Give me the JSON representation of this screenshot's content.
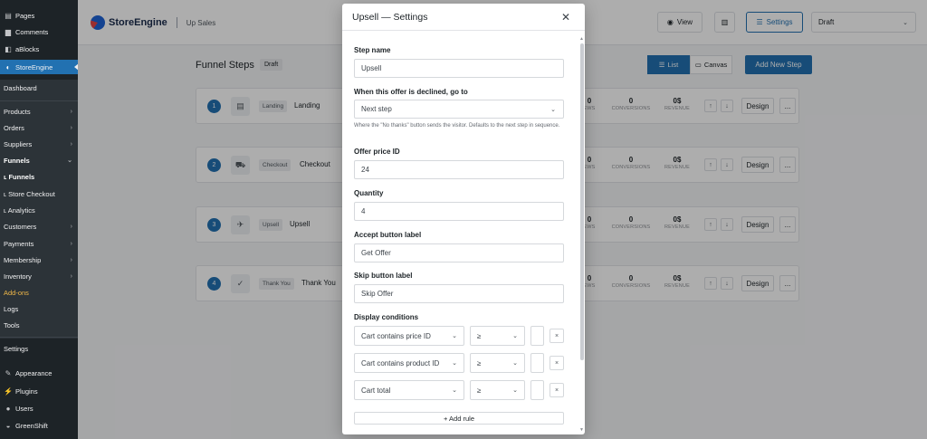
{
  "wp_menu": {
    "pages": "Pages",
    "comments": "Comments",
    "ablocks": "aBlocks",
    "storeengine": "StoreEngine",
    "dashboard": "Dashboard",
    "products": "Products",
    "orders": "Orders",
    "suppliers": "Suppliers",
    "funnels": "Funnels",
    "sub_funnels": "ʟ Funnels",
    "sub_store_checkout": "ʟ Store Checkout",
    "sub_analytics": "ʟ Analytics",
    "customers": "Customers",
    "payments": "Payments",
    "membership": "Membership",
    "inventory": "Inventory",
    "addons": "Add-ons",
    "logs": "Logs",
    "tools": "Tools",
    "settings": "Settings",
    "appearance": "Appearance",
    "plugins": "Plugins",
    "users": "Users",
    "greenshift": "GreenShift"
  },
  "header": {
    "logo_text": "StoreEngine",
    "crumb": "Up Sales",
    "view_label": "View",
    "settings_label": "Settings",
    "status_value": "Draft"
  },
  "funnel": {
    "title": "Funnel Steps",
    "badge": "Draft",
    "list_label": "List",
    "canvas_label": "Canvas",
    "add_step_label": "Add New Step"
  },
  "steps": [
    {
      "num": "1",
      "tag": "Landing",
      "name": "Landing",
      "views": "0",
      "conversions": "0",
      "revenue": "0$"
    },
    {
      "num": "2",
      "tag": "Checkout",
      "name": "Checkout",
      "views": "0",
      "conversions": "0",
      "revenue": "0$"
    },
    {
      "num": "3",
      "tag": "Upsell",
      "name": "Upsell",
      "views": "0",
      "conversions": "0",
      "revenue": "0$"
    },
    {
      "num": "4",
      "tag": "Thank You",
      "name": "Thank You",
      "views": "0",
      "conversions": "0",
      "revenue": "0$"
    }
  ],
  "stat_labels": {
    "views": "EWS",
    "conversions": "CONVERSIONS",
    "revenue": "REVENUE"
  },
  "step_actions": {
    "design": "Design",
    "more": "...",
    "up": "↑",
    "down": "↓"
  },
  "modal": {
    "title": "Upsell — Settings",
    "close": "✕",
    "step_name_label": "Step name",
    "step_name_value": "Upsell",
    "declined_label": "When this offer is declined, go to",
    "declined_value": "Next step",
    "declined_help": "Where the \"No thanks\" button sends the visitor. Defaults to the next step in sequence.",
    "offer_price_label": "Offer price ID",
    "offer_price_value": "24",
    "quantity_label": "Quantity",
    "quantity_value": "4",
    "accept_label": "Accept button label",
    "accept_value": "Get Offer",
    "skip_label": "Skip button label",
    "skip_value": "Skip Offer",
    "conditions_label": "Display conditions",
    "rules": [
      {
        "field": "Cart contains price ID",
        "op": "≥",
        "del": "×"
      },
      {
        "field": "Cart contains product ID",
        "op": "≥",
        "del": "×"
      },
      {
        "field": "Cart total",
        "op": "≥",
        "del": "×"
      }
    ],
    "add_rule": "+ Add rule"
  },
  "icons": {
    "chev_right": "›",
    "chev_down": "⌄"
  }
}
